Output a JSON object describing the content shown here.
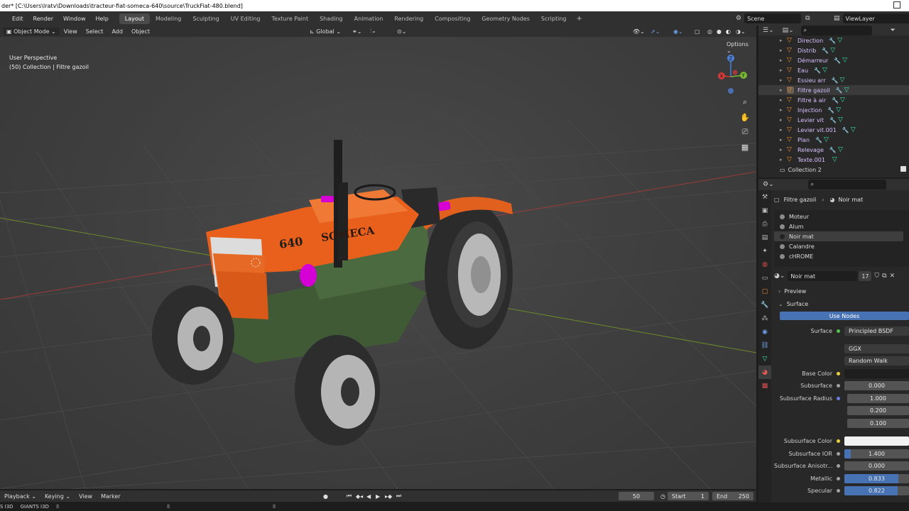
{
  "window": {
    "title": "der* [C:\\Users\\lratv\\Downloads\\tracteur-fiat-someca-640\\source\\TruckFiat-480.blend]"
  },
  "menu": [
    "Edit",
    "Render",
    "Window",
    "Help"
  ],
  "workspaces": {
    "tabs": [
      "Layout",
      "Modeling",
      "Sculpting",
      "UV Editing",
      "Texture Paint",
      "Shading",
      "Animation",
      "Rendering",
      "Compositing",
      "Geometry Nodes",
      "Scripting"
    ],
    "active": "Layout",
    "add": "+"
  },
  "scene": {
    "name": "Scene",
    "view_layer": "ViewLayer"
  },
  "viewport_header": {
    "mode": "Object Mode",
    "menus": [
      "View",
      "Select",
      "Add",
      "Object"
    ],
    "transform_orientation": "Global",
    "options_label": "Options"
  },
  "viewport": {
    "perspective": "User Perspective",
    "collection_info": "(50) Collection | Filtre gazoil",
    "model_label_number": "640",
    "model_label_brand": "SOMECA",
    "gizmo": {
      "z": "Z",
      "y": "Y",
      "x": "X"
    }
  },
  "outliner": {
    "items": [
      {
        "name": "Direction"
      },
      {
        "name": "Distrib"
      },
      {
        "name": "Démarreur"
      },
      {
        "name": "Eau"
      },
      {
        "name": "Essieu arr"
      },
      {
        "name": "Filtre gazoil",
        "selected": true
      },
      {
        "name": "Filtre à air"
      },
      {
        "name": "Injection"
      },
      {
        "name": "Levier vit"
      },
      {
        "name": "Levier vit.001"
      },
      {
        "name": "Plan"
      },
      {
        "name": "Relevage"
      },
      {
        "name": "Texte.001"
      }
    ],
    "collection": "Collection 2"
  },
  "properties": {
    "breadcrumb": {
      "object": "Filtre gazoil",
      "material": "Noir mat"
    },
    "slots": [
      "Moteur",
      "Alum",
      "Noir mat",
      "Calandre",
      "cHROME"
    ],
    "selected_slot": "Noir mat",
    "material_name": "Noir mat",
    "users": "17",
    "sections": {
      "preview": "Preview",
      "surface": "Surface"
    },
    "use_nodes": "Use Nodes",
    "surface": {
      "surface_label": "Surface",
      "surface_value": "Principled BSDF",
      "distribution": "GGX",
      "subsurface_method": "Random Walk",
      "rows": [
        {
          "label": "Base Color",
          "value": "",
          "kind": "dark",
          "dot": "y"
        },
        {
          "label": "Subsurface",
          "value": "0.000",
          "kind": "num",
          "dot": ""
        },
        {
          "label": "Subsurface Radius",
          "value": "1.000",
          "kind": "num",
          "dot": "b"
        },
        {
          "label": "",
          "value": "0.200",
          "kind": "num",
          "dot": "none"
        },
        {
          "label": "",
          "value": "0.100",
          "kind": "num",
          "dot": "none"
        },
        {
          "label": "Subsurface Color",
          "value": "",
          "kind": "white",
          "dot": "y"
        },
        {
          "label": "Subsurface IOR",
          "value": "1.400",
          "kind": "num",
          "dot": "",
          "fill": 0.1
        },
        {
          "label": "Subsurface Anisotr...",
          "value": "0.000",
          "kind": "num",
          "dot": ""
        },
        {
          "label": "Metallic",
          "value": "0.833",
          "kind": "num",
          "dot": "",
          "fill": 0.833
        },
        {
          "label": "Specular",
          "value": "0.822",
          "kind": "num",
          "dot": "",
          "fill": 0.822
        }
      ]
    }
  },
  "timeline": {
    "menus": [
      "Playback",
      "Keying",
      "View",
      "Marker"
    ],
    "current_frame": "50",
    "start_label": "Start",
    "start": "1",
    "end_label": "End",
    "end": "250"
  },
  "statusbar": {
    "left1": "S I3D",
    "left2": "GIANTS I3D"
  },
  "colors": {
    "accent": "#4772b3",
    "object_orange": "#f08a2c",
    "mesh_green": "#35e8b0",
    "tractor_orange": "#e8601c"
  }
}
